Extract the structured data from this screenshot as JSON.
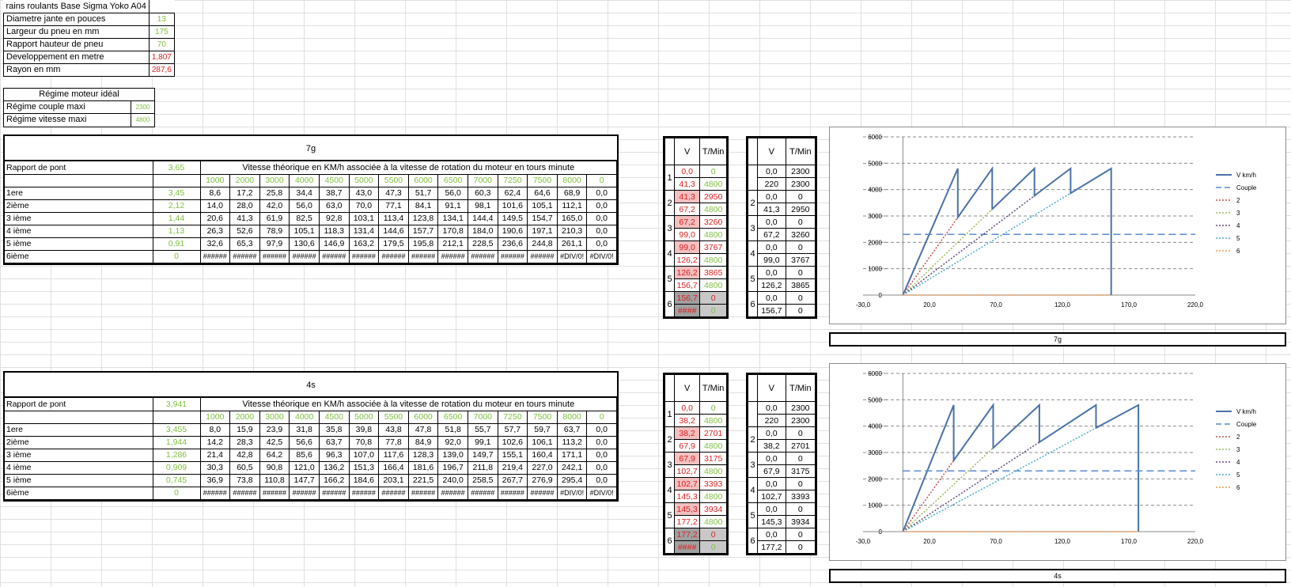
{
  "params": [
    {
      "label": "rains roulants Base Sigma Yoko A04",
      "value": "",
      "cls": ""
    },
    {
      "label": "Diametre jante en pouces",
      "value": "13",
      "cls": "g"
    },
    {
      "label": "Largeur du pneu en mm",
      "value": "175",
      "cls": "g"
    },
    {
      "label": "Rapport hauteur de pneu",
      "value": "70",
      "cls": "g"
    },
    {
      "label": "Developpement en metre",
      "value": "1,807",
      "cls": "r"
    },
    {
      "label": "Rayon en mm",
      "value": "287,6",
      "cls": "r"
    }
  ],
  "ideal": {
    "title": "Régime moteur idéal",
    "rows": [
      {
        "label": "Régime couple maxi",
        "value": "2300"
      },
      {
        "label": "Régime vitesse maxi",
        "value": "4800"
      }
    ]
  },
  "blocks": [
    {
      "title": "7g",
      "pont_label": "Rapport de pont",
      "pont_value": "3,65",
      "header_text": "Vitesse théorique en KM/h associée à la vitesse de rotation du moteur en tours minute",
      "rpms": [
        "1000",
        "2000",
        "3000",
        "4000",
        "4500",
        "5000",
        "5500",
        "6000",
        "6500",
        "7000",
        "7250",
        "7500",
        "8000",
        "0"
      ],
      "rows": [
        {
          "label": "1ere",
          "ratio": "3,45",
          "cells": [
            "8,6",
            "17,2",
            "25,8",
            "34,4",
            "38,7",
            "43,0",
            "47,3",
            "51,7",
            "56,0",
            "60,3",
            "62,4",
            "64,6",
            "68,9",
            "0,0"
          ]
        },
        {
          "label": "2ième",
          "ratio": "2,12",
          "cells": [
            "14,0",
            "28,0",
            "42,0",
            "56,0",
            "63,0",
            "70,0",
            "77,1",
            "84,1",
            "91,1",
            "98,1",
            "101,6",
            "105,1",
            "112,1",
            "0,0"
          ]
        },
        {
          "label": "3 ième",
          "ratio": "1,44",
          "cells": [
            "20,6",
            "41,3",
            "61,9",
            "82,5",
            "92,8",
            "103,1",
            "113,4",
            "123,8",
            "134,1",
            "144,4",
            "149,5",
            "154,7",
            "165,0",
            "0,0"
          ]
        },
        {
          "label": "4 ième",
          "ratio": "1,13",
          "cells": [
            "26,3",
            "52,6",
            "78,9",
            "105,1",
            "118,3",
            "131,4",
            "144,6",
            "157,7",
            "170,8",
            "184,0",
            "190,6",
            "197,1",
            "210,3",
            "0,0"
          ]
        },
        {
          "label": "5 ième",
          "ratio": "0,91",
          "cells": [
            "32,6",
            "65,3",
            "97,9",
            "130,6",
            "146,9",
            "163,2",
            "179,5",
            "195,8",
            "212,1",
            "228,5",
            "236,6",
            "244,8",
            "261,1",
            "0,0"
          ]
        },
        {
          "label": "6ième",
          "ratio": "0",
          "cells": [
            "######",
            "######",
            "######",
            "######",
            "######",
            "######",
            "######",
            "######",
            "######",
            "######",
            "######",
            "######",
            "#DIV/0!",
            "#DIV/0!"
          ]
        }
      ],
      "sideA": {
        "hV": "V",
        "hT": "T/Min",
        "rows": [
          {
            "g": "1",
            "v": "0,0",
            "t": "0",
            "vc": "r",
            "tc": "g"
          },
          {
            "g": "",
            "v": "41,3",
            "t": "4800",
            "vc": "r",
            "tc": "g"
          },
          {
            "g": "2",
            "v": "41,3",
            "t": "2950",
            "vc": "r",
            "tc": "r"
          },
          {
            "g": "",
            "v": "67,2",
            "t": "4800",
            "vc": "r",
            "tc": "g"
          },
          {
            "g": "3",
            "v": "67,2",
            "t": "3260",
            "vc": "r",
            "tc": "r"
          },
          {
            "g": "",
            "v": "99,0",
            "t": "4800",
            "vc": "r",
            "tc": "g"
          },
          {
            "g": "4",
            "v": "99,0",
            "t": "3767",
            "vc": "r",
            "tc": "r"
          },
          {
            "g": "",
            "v": "126,2",
            "t": "4800",
            "vc": "r",
            "tc": "g"
          },
          {
            "g": "5",
            "v": "126,2",
            "t": "3865",
            "vc": "r",
            "tc": "r"
          },
          {
            "g": "",
            "v": "156,7",
            "t": "4800",
            "vc": "r",
            "tc": "g"
          },
          {
            "g": "6",
            "v": "156,7",
            "t": "0",
            "vc": "r",
            "tc": "r"
          },
          {
            "g": "",
            "v": "####",
            "t": "0",
            "vc": "r",
            "tc": "g"
          }
        ]
      },
      "sideB": {
        "hV": "V",
        "hT": "T/Min",
        "rows": [
          {
            "g": "",
            "v": "0,0",
            "t": "2300"
          },
          {
            "g": "",
            "v": "220",
            "t": "2300"
          },
          {
            "g": "2",
            "v": "0,0",
            "t": "0"
          },
          {
            "g": "",
            "v": "41,3",
            "t": "2950"
          },
          {
            "g": "3",
            "v": "0,0",
            "t": "0"
          },
          {
            "g": "",
            "v": "67,2",
            "t": "3260"
          },
          {
            "g": "4",
            "v": "0,0",
            "t": "0"
          },
          {
            "g": "",
            "v": "99,0",
            "t": "3767"
          },
          {
            "g": "5",
            "v": "0,0",
            "t": "0"
          },
          {
            "g": "",
            "v": "126,2",
            "t": "3865"
          },
          {
            "g": "6",
            "v": "0,0",
            "t": "0"
          },
          {
            "g": "",
            "v": "156,7",
            "t": "0"
          }
        ]
      },
      "caption": "7g"
    },
    {
      "title": "4s",
      "pont_label": "Rapport de pont",
      "pont_value": "3,941",
      "header_text": "Vitesse théorique en KM/h associée à la vitesse de rotation du moteur en tours minute",
      "rpms": [
        "1000",
        "2000",
        "3000",
        "4000",
        "4500",
        "5000",
        "5500",
        "6000",
        "6500",
        "7000",
        "7250",
        "7500",
        "8000",
        "0"
      ],
      "rows": [
        {
          "label": "1ere",
          "ratio": "3,455",
          "cells": [
            "8,0",
            "15,9",
            "23,9",
            "31,8",
            "35,8",
            "39,8",
            "43,8",
            "47,8",
            "51,8",
            "55,7",
            "57,7",
            "59,7",
            "63,7",
            "0,0"
          ]
        },
        {
          "label": "2ième",
          "ratio": "1,944",
          "cells": [
            "14,2",
            "28,3",
            "42,5",
            "56,6",
            "63,7",
            "70,8",
            "77,8",
            "84,9",
            "92,0",
            "99,1",
            "102,6",
            "106,1",
            "113,2",
            "0,0"
          ]
        },
        {
          "label": "3 ième",
          "ratio": "1,286",
          "cells": [
            "21,4",
            "42,8",
            "64,2",
            "85,6",
            "96,3",
            "107,0",
            "117,6",
            "128,3",
            "139,0",
            "149,7",
            "155,1",
            "160,4",
            "171,1",
            "0,0"
          ]
        },
        {
          "label": "4 ième",
          "ratio": "0,909",
          "cells": [
            "30,3",
            "60,5",
            "90,8",
            "121,0",
            "136,2",
            "151,3",
            "166,4",
            "181,6",
            "196,7",
            "211,8",
            "219,4",
            "227,0",
            "242,1",
            "0,0"
          ]
        },
        {
          "label": "5 ième",
          "ratio": "0,745",
          "cells": [
            "36,9",
            "73,8",
            "110,8",
            "147,7",
            "166,2",
            "184,6",
            "203,1",
            "221,5",
            "240,0",
            "258,5",
            "267,7",
            "276,9",
            "295,4",
            "0,0"
          ]
        },
        {
          "label": "6ième",
          "ratio": "0",
          "cells": [
            "######",
            "######",
            "######",
            "######",
            "######",
            "######",
            "######",
            "######",
            "######",
            "######",
            "######",
            "######",
            "#DIV/0!",
            "#DIV/0!"
          ]
        }
      ],
      "sideA": {
        "hV": "V",
        "hT": "T/Min",
        "rows": [
          {
            "g": "1",
            "v": "0,0",
            "t": "0",
            "vc": "r",
            "tc": "g"
          },
          {
            "g": "",
            "v": "38,2",
            "t": "4800",
            "vc": "r",
            "tc": "g"
          },
          {
            "g": "2",
            "v": "38,2",
            "t": "2701",
            "vc": "r",
            "tc": "r"
          },
          {
            "g": "",
            "v": "67,9",
            "t": "4800",
            "vc": "r",
            "tc": "g"
          },
          {
            "g": "3",
            "v": "67,9",
            "t": "3175",
            "vc": "r",
            "tc": "r"
          },
          {
            "g": "",
            "v": "102,7",
            "t": "4800",
            "vc": "r",
            "tc": "g"
          },
          {
            "g": "4",
            "v": "102,7",
            "t": "3393",
            "vc": "r",
            "tc": "r"
          },
          {
            "g": "",
            "v": "145,3",
            "t": "4800",
            "vc": "r",
            "tc": "g"
          },
          {
            "g": "5",
            "v": "145,3",
            "t": "3934",
            "vc": "r",
            "tc": "r"
          },
          {
            "g": "",
            "v": "177,2",
            "t": "4800",
            "vc": "r",
            "tc": "g"
          },
          {
            "g": "6",
            "v": "177,2",
            "t": "0",
            "vc": "r",
            "tc": "r"
          },
          {
            "g": "",
            "v": "####",
            "t": "0",
            "vc": "r",
            "tc": "g"
          }
        ]
      },
      "sideB": {
        "hV": "V",
        "hT": "T/Min",
        "rows": [
          {
            "g": "",
            "v": "0,0",
            "t": "2300"
          },
          {
            "g": "",
            "v": "220",
            "t": "2300"
          },
          {
            "g": "2",
            "v": "0,0",
            "t": "0"
          },
          {
            "g": "",
            "v": "38,2",
            "t": "2701"
          },
          {
            "g": "3",
            "v": "0,0",
            "t": "0"
          },
          {
            "g": "",
            "v": "67,9",
            "t": "3175"
          },
          {
            "g": "4",
            "v": "0,0",
            "t": "0"
          },
          {
            "g": "",
            "v": "102,7",
            "t": "3393"
          },
          {
            "g": "5",
            "v": "0,0",
            "t": "0"
          },
          {
            "g": "",
            "v": "145,3",
            "t": "3934"
          },
          {
            "g": "6",
            "v": "0,0",
            "t": "0"
          },
          {
            "g": "",
            "v": "177,2",
            "t": "0"
          }
        ]
      },
      "caption": "4s"
    }
  ],
  "chart_data": [
    {
      "type": "line",
      "title": "",
      "xlim": [
        -30,
        220
      ],
      "ylim": [
        0,
        6000
      ],
      "xticks": [
        "-30,0",
        "20,0",
        "70,0",
        "120,0",
        "170,0",
        "220,0"
      ],
      "yticks": [
        "0",
        "1000",
        "2000",
        "3000",
        "4000",
        "5000",
        "6000"
      ],
      "legend": "right",
      "grid": "horizontal dashed",
      "series": [
        {
          "name": "V km/h",
          "color": "#4a72a8",
          "style": "solid",
          "points": [
            [
              0,
              0
            ],
            [
              41.3,
              4800
            ],
            [
              41.3,
              2950
            ],
            [
              67.2,
              4800
            ],
            [
              67.2,
              3260
            ],
            [
              99.0,
              4800
            ],
            [
              99.0,
              3767
            ],
            [
              126.2,
              4800
            ],
            [
              126.2,
              3865
            ],
            [
              156.7,
              4800
            ],
            [
              156.7,
              0
            ]
          ]
        },
        {
          "name": "Couple",
          "color": "#5b8ad0",
          "style": "dash",
          "points": [
            [
              0,
              2300
            ],
            [
              220,
              2300
            ]
          ]
        },
        {
          "name": "2",
          "color": "#c0504d",
          "style": "dot",
          "points": [
            [
              0,
              0
            ],
            [
              41.3,
              2950
            ]
          ]
        },
        {
          "name": "3",
          "color": "#9bbb59",
          "style": "dot",
          "points": [
            [
              0,
              0
            ],
            [
              67.2,
              3260
            ]
          ]
        },
        {
          "name": "4",
          "color": "#604a7b",
          "style": "dot",
          "points": [
            [
              0,
              0
            ],
            [
              99.0,
              3767
            ]
          ]
        },
        {
          "name": "5",
          "color": "#4bacc6",
          "style": "dot",
          "points": [
            [
              0,
              0
            ],
            [
              126.2,
              3865
            ]
          ]
        },
        {
          "name": "6",
          "color": "#f79646",
          "style": "dot",
          "points": [
            [
              0,
              0
            ],
            [
              156.7,
              0
            ]
          ]
        }
      ]
    },
    {
      "type": "line",
      "title": "",
      "xlim": [
        -30,
        220
      ],
      "ylim": [
        0,
        6000
      ],
      "xticks": [
        "-30,0",
        "20,0",
        "70,0",
        "120,0",
        "170,0",
        "220,0"
      ],
      "yticks": [
        "0",
        "1000",
        "2000",
        "3000",
        "4000",
        "5000",
        "6000"
      ],
      "legend": "right",
      "grid": "horizontal dashed",
      "series": [
        {
          "name": "V km/h",
          "color": "#4a72a8",
          "style": "solid",
          "points": [
            [
              0,
              0
            ],
            [
              38.2,
              4800
            ],
            [
              38.2,
              2701
            ],
            [
              67.9,
              4800
            ],
            [
              67.9,
              3175
            ],
            [
              102.7,
              4800
            ],
            [
              102.7,
              3393
            ],
            [
              145.3,
              4800
            ],
            [
              145.3,
              3934
            ],
            [
              177.2,
              4800
            ],
            [
              177.2,
              0
            ]
          ]
        },
        {
          "name": "Couple",
          "color": "#5b8ad0",
          "style": "dash",
          "points": [
            [
              0,
              2300
            ],
            [
              220,
              2300
            ]
          ]
        },
        {
          "name": "2",
          "color": "#c0504d",
          "style": "dot",
          "points": [
            [
              0,
              0
            ],
            [
              38.2,
              2701
            ]
          ]
        },
        {
          "name": "3",
          "color": "#9bbb59",
          "style": "dot",
          "points": [
            [
              0,
              0
            ],
            [
              67.9,
              3175
            ]
          ]
        },
        {
          "name": "4",
          "color": "#604a7b",
          "style": "dot",
          "points": [
            [
              0,
              0
            ],
            [
              102.7,
              3393
            ]
          ]
        },
        {
          "name": "5",
          "color": "#4bacc6",
          "style": "dot",
          "points": [
            [
              0,
              0
            ],
            [
              145.3,
              3934
            ]
          ]
        },
        {
          "name": "6",
          "color": "#f79646",
          "style": "dot",
          "points": [
            [
              0,
              0
            ],
            [
              177.2,
              0
            ]
          ]
        }
      ]
    }
  ]
}
